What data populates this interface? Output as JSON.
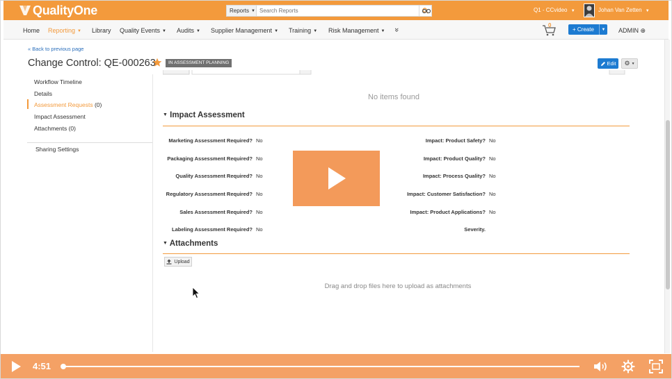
{
  "app": {
    "brand": "QualityOne",
    "search": {
      "scope": "Reports",
      "placeholder": "Search Reports"
    },
    "vault_selector": "Q1 - CCvideo",
    "user_name": "Johan Van Zetten"
  },
  "nav": {
    "items": [
      {
        "label": "Home",
        "caret": ""
      },
      {
        "label": "Reporting",
        "caret": "▼"
      },
      {
        "label": "Library",
        "caret": ""
      },
      {
        "label": "Quality Events",
        "caret": "▼"
      },
      {
        "label": "Audits",
        "caret": "▼"
      },
      {
        "label": "Supplier Management",
        "caret": "▼"
      },
      {
        "label": "Training",
        "caret": "▼"
      },
      {
        "label": "Risk Management",
        "caret": "▼"
      },
      {
        "label": "»",
        "caret": ""
      }
    ],
    "cart_count": "0",
    "create_label": "+ Create",
    "admin_label": "ADMIN ⊕"
  },
  "header": {
    "back_link": "« Back to previous page",
    "title": "Change Control: QE-000263",
    "status": "IN ASSESSMENT PLANNING",
    "edit_label": "Edit"
  },
  "sidebar": {
    "items": [
      {
        "label": "Workflow Timeline"
      },
      {
        "label": "Details"
      },
      {
        "label": "Assessment Requests",
        "count": "(0)"
      },
      {
        "label": "Impact Assessment"
      },
      {
        "label": "Attachments (0)"
      }
    ],
    "sharing_label": "Sharing Settings"
  },
  "main": {
    "no_items": "No items found",
    "impact": {
      "title": "Impact Assessment",
      "left": [
        {
          "label": "Marketing Assessment Required?",
          "value": "No"
        },
        {
          "label": "Packaging Assessment Required?",
          "value": "No"
        },
        {
          "label": "Quality Assessment Required?",
          "value": "No"
        },
        {
          "label": "Regulatory Assessment Required?",
          "value": "No"
        },
        {
          "label": "Sales Assessment Required?",
          "value": "No"
        },
        {
          "label": "Labeling Assessment Required?",
          "value": "No"
        }
      ],
      "right": [
        {
          "label": "Impact: Product Safety?",
          "value": "No"
        },
        {
          "label": "Impact: Product Quality?",
          "value": "No"
        },
        {
          "label": "Impact: Process Quality?",
          "value": "No"
        },
        {
          "label": "Impact: Customer Satisfaction?",
          "value": "No"
        },
        {
          "label": "Impact: Product Applications?",
          "value": "No"
        },
        {
          "label": "Severity.",
          "value": ""
        }
      ]
    },
    "attachments": {
      "title": "Attachments",
      "upload_label": "Upload",
      "drop_hint": "Drag and drop files here to upload as attachments"
    }
  },
  "video": {
    "time": "4:51",
    "progress": 0.0
  },
  "colors": {
    "accent": "#f39a3c",
    "primary_button": "#1d7bd1",
    "player_bar": "#f4a165"
  }
}
